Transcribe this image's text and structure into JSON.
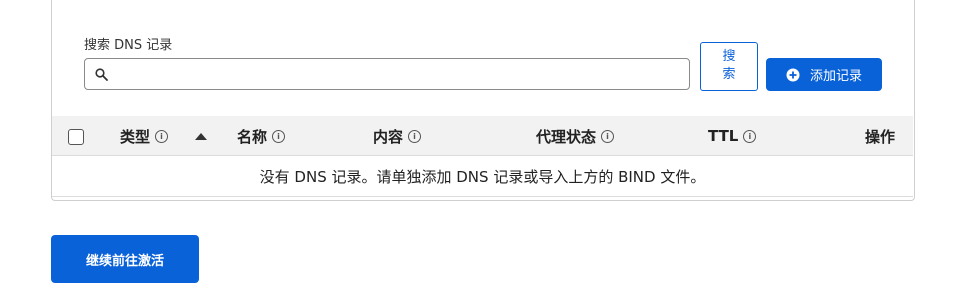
{
  "search": {
    "label": "搜索 DNS 记录",
    "value": "",
    "button_label_line1": "搜",
    "button_label_line2": "索",
    "icon": "search-icon"
  },
  "add_record_button": {
    "label": "添加记录",
    "icon": "plus-circle-icon"
  },
  "table": {
    "columns": [
      {
        "label": "类型",
        "info": "i"
      },
      {
        "label": "名称",
        "info": "i"
      },
      {
        "label": "内容",
        "info": "i"
      },
      {
        "label": "代理状态",
        "info": "i"
      },
      {
        "label": "TTL",
        "info": "i"
      },
      {
        "label": "操作"
      }
    ],
    "empty_message": "没有 DNS 记录。请单独添加 DNS 记录或导入上方的 BIND 文件。"
  },
  "continue_button": {
    "label": "继续前往激活"
  },
  "colors": {
    "accent": "#0a62d9",
    "header_bg": "#f2f2f2"
  }
}
